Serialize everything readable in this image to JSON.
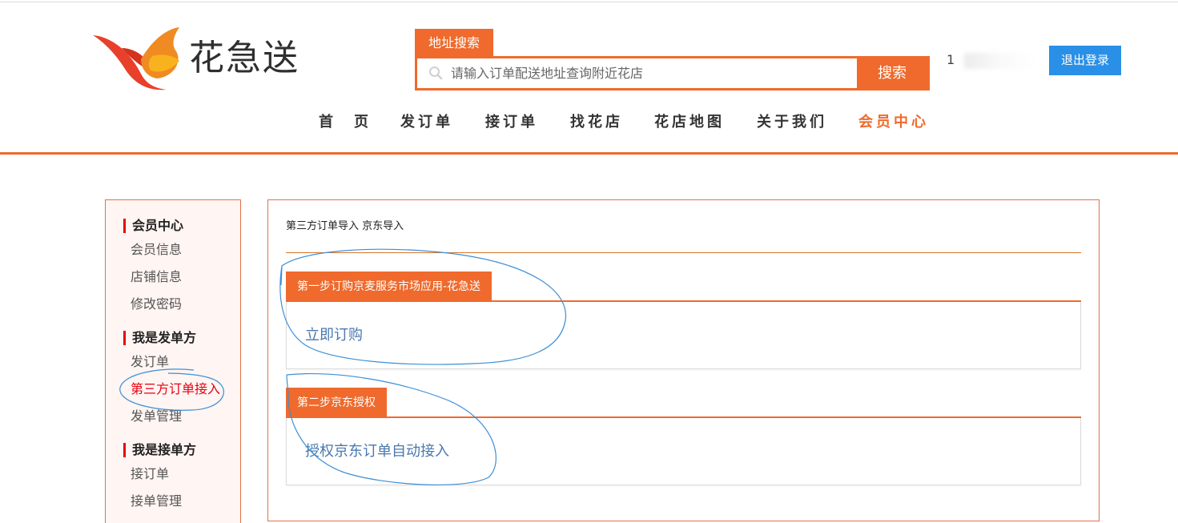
{
  "brand": {
    "name": "花急送"
  },
  "search": {
    "tab_label": "地址搜索",
    "placeholder": "请输入订单配送地址查询附近花店",
    "button_label": "搜索"
  },
  "user": {
    "account_partial": "1",
    "logout_label": "退出登录"
  },
  "nav": {
    "items": [
      {
        "label": "首　页"
      },
      {
        "label": "发订单"
      },
      {
        "label": "接订单"
      },
      {
        "label": "找花店"
      },
      {
        "label": "花店地图"
      },
      {
        "label": "关于我们"
      },
      {
        "label": "会员中心"
      }
    ]
  },
  "sidebar": {
    "groups": [
      {
        "title": "会员中心",
        "items": [
          "会员信息",
          "店铺信息",
          "修改密码"
        ]
      },
      {
        "title": "我是发单方",
        "items": [
          "发订单",
          "第三方订单接入",
          "发单管理"
        ]
      },
      {
        "title": "我是接单方",
        "items": [
          "接订单",
          "接单管理"
        ]
      }
    ]
  },
  "main": {
    "breadcrumb": "第三方订单导入 京东导入",
    "steps": [
      {
        "title": "第一步订购京麦服务市场应用-花急送",
        "action": "立即订购"
      },
      {
        "title": "第二步京东授权",
        "action": "授权京东订单自动接入"
      }
    ]
  },
  "colors": {
    "accent": "#ef6a2c",
    "logout": "#2a8fe6",
    "link": "#4a78ad",
    "current": "#e60012",
    "annotation": "#3d8fd6"
  }
}
